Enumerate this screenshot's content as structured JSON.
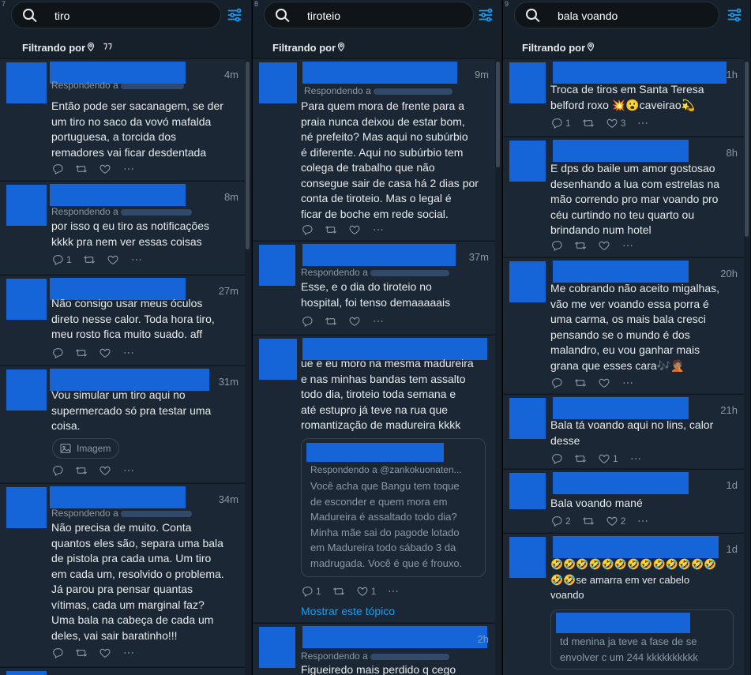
{
  "columns": [
    {
      "number": "7",
      "query": "tiro",
      "filter_label": "Filtrando por",
      "tweets": [
        {
          "time": "4m",
          "replying": "Respondendo a",
          "text": "Então pode ser sacanagem, se der\num tiro no saco da vovó mafalda\nportuguesa, a torcida dos\nremadores vai ficar desdentada",
          "reply_count": "",
          "like_count": ""
        },
        {
          "time": "8m",
          "replying": "Respondendo a",
          "text": "por isso q eu tiro as notificações\nkkkk pra nem ver essas coisas",
          "reply_count": "1",
          "like_count": ""
        },
        {
          "time": "27m",
          "replying": "",
          "text": "Não consigo usar meus óculos\ndireto nesse calor. Toda hora tiro,\nmeu rosto fica muito suado. aff",
          "reply_count": "",
          "like_count": ""
        },
        {
          "time": "31m",
          "replying": "",
          "text": "Vou simular um tiro aqui no\nsupermercado só pra testar uma\ncoisa.",
          "media_label": "Imagem",
          "reply_count": "",
          "like_count": ""
        },
        {
          "time": "34m",
          "replying": "Respondendo a",
          "text": "Não precisa de muito. Conta\nquantos eles são, separa uma bala\nde pistola pra cada uma. Um tiro\nem cada um, resolvido o problema.\nJá parou pra pensar quantas\nvítimas, cada um marginal faz?\nUma bala na cabeça de cada um\ndeles, vai sair baratinho!!!",
          "reply_count": "",
          "like_count": ""
        }
      ]
    },
    {
      "number": "8",
      "query": "tiroteio",
      "filter_label": "Filtrando por",
      "tweets": [
        {
          "time": "9m",
          "replying": "Respondendo a",
          "text": "Para quem mora de frente para a\npraia nunca deixou de estar bom,\nné prefeito? Mas aqui no subúrbio\né diferente. Aqui no subúrbio tem\ncolega de trabalho que não\nconsegue sair de casa há 2 dias por\nconta de tiroteio. Mas o legal é\nficar de boche em rede social.",
          "reply_count": "",
          "like_count": ""
        },
        {
          "time": "37m",
          "replying": "Respondendo a",
          "text": "Esse, e o dia do tiroteio no\nhospital, foi tenso demaaaaais",
          "reply_count": "",
          "like_count": ""
        },
        {
          "time": "",
          "replying": "",
          "text": "ue e eu moro na mesma madureira\ne nas minhas bandas tem assalto\ntodo dia, tiroteio toda semana e\naté estupro já teve na rua que\nromantização de madureira kkkk",
          "quote_replying": "Respondendo a @zankokuonaten...",
          "quote_text": "Você acha que Bangu tem toque\nde esconder e quem mora em\nMadureira é assaltado todo dia?\nMinha mãe sai do pagode lotado\nem Madureira todo sábado 3 da\nmadrugada. Você é que é frouxo.",
          "reply_count": "1",
          "like_count": "1",
          "show_thread": "Mostrar este tópico"
        },
        {
          "time": "2h",
          "replying": "Respondendo a",
          "text": "Figueiredo mais perdido q cego",
          "reply_count": "",
          "like_count": ""
        }
      ]
    },
    {
      "number": "9",
      "query": "bala voando",
      "filter_label": "Filtrando por",
      "tweets": [
        {
          "time": "1h",
          "text": "Troca de tiros em Santa Teresa\nbelford roxo 💥😮caveirao💫",
          "reply_count": "1",
          "like_count": "3"
        },
        {
          "time": "8h",
          "text": "E dps do baile um amor gostosao\ndesenhando a lua com estrelas na\nmão correndo pro mar voando pro\ncéu curtindo no teu quarto ou\nbrindando num hotel",
          "reply_count": "",
          "like_count": ""
        },
        {
          "time": "20h",
          "text": "Me cobrando não aceito migalhas,\nvão me ver voando essa porra é\numa carma, os mais bala cresci\npensando se o mundo é dos\nmalandro, eu vou ganhar mais\ngrana que esses cara🎶🤦🏽",
          "reply_count": "",
          "like_count": ""
        },
        {
          "time": "21h",
          "text": "Bala tá voando aqui no lins, calor\ndesse",
          "reply_count": "",
          "like_count": "1"
        },
        {
          "time": "1d",
          "text": "Bala voando mané",
          "reply_count": "2",
          "like_count": "2"
        },
        {
          "time": "1d",
          "text": "🤣🤣🤣🤣🤣🤣🤣🤣🤣🤣🤣🤣🤣\n🤣🤣se amarra em ver cabelo\nvoando",
          "quote_text": "td menina ja teve a fase de se\nenvolver c um 244 kkkkkkkkkk",
          "reply_count": "",
          "like_count": ""
        }
      ]
    }
  ],
  "colors": {
    "column_bg": "#15202b",
    "tweet_bg": "#1b2734",
    "redaction": "#1565d8",
    "link": "#1d9bf0",
    "muted": "#8b98a5"
  }
}
